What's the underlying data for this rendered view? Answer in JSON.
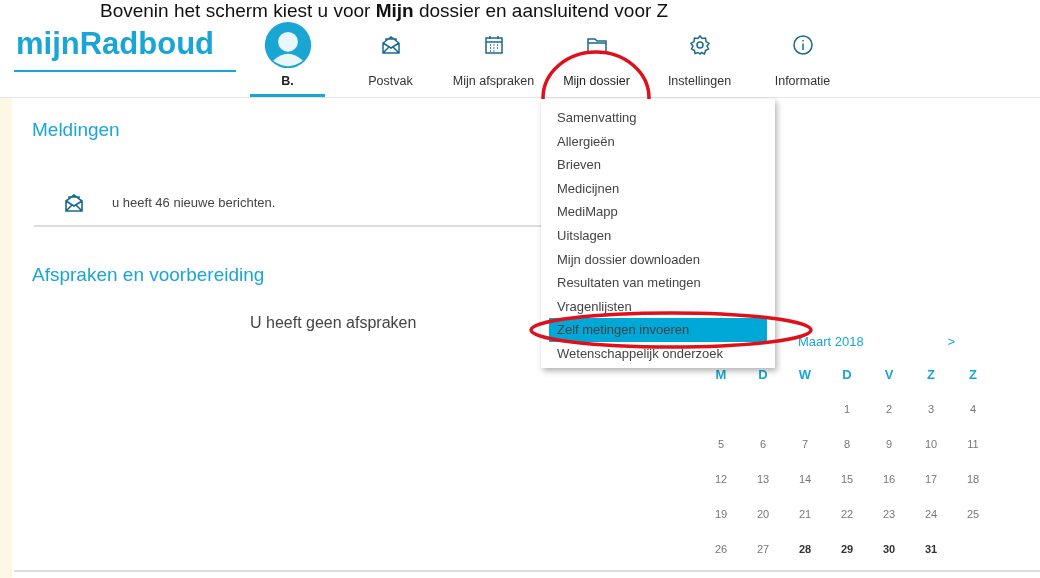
{
  "caption": "Bovenin het scherm kiest u voor **Mijn** dossier en aansluitend voor Z",
  "logo": "mijnRadboud",
  "nav": [
    {
      "kind": "avatar",
      "label": "B.",
      "selected": true,
      "circled": false
    },
    {
      "kind": "mail",
      "label": "Postvak",
      "selected": false,
      "circled": false
    },
    {
      "kind": "calendar",
      "label": "Mijn afspraken",
      "selected": false,
      "circled": false
    },
    {
      "kind": "folder",
      "label": "Mijn dossier",
      "selected": false,
      "circled": true
    },
    {
      "kind": "gear",
      "label": "Instellingen",
      "selected": false,
      "circled": false
    },
    {
      "kind": "info",
      "label": "Informatie",
      "selected": false,
      "circled": false
    }
  ],
  "menu": [
    {
      "label": "Samenvatting",
      "selected": false,
      "circled": false
    },
    {
      "label": "Allergieën",
      "selected": false,
      "circled": false
    },
    {
      "label": "Brieven",
      "selected": false,
      "circled": false
    },
    {
      "label": "Medicijnen",
      "selected": false,
      "circled": false
    },
    {
      "label": "MediMapp",
      "selected": false,
      "circled": false
    },
    {
      "label": "Uitslagen",
      "selected": false,
      "circled": false
    },
    {
      "label": "Mijn dossier downloaden",
      "selected": false,
      "circled": false
    },
    {
      "label": "Resultaten van metingen",
      "selected": false,
      "circled": false
    },
    {
      "label": "Vragenlijsten",
      "selected": false,
      "circled": false
    },
    {
      "label": "Zelf metingen invoeren",
      "selected": true,
      "circled": true
    },
    {
      "label": "Wetenschappelijk onderzoek",
      "selected": false,
      "circled": false
    }
  ],
  "notifications": {
    "title": "Meldingen",
    "message": "u heeft 46 nieuwe berichten."
  },
  "appointments": {
    "title": "Afspraken en voorbereiding",
    "empty_text": "U heeft geen afspraken"
  },
  "calendar": {
    "month": "Maart 2018",
    "next": ">",
    "weekdays": [
      "M",
      "D",
      "W",
      "D",
      "V",
      "Z",
      "Z"
    ],
    "weeks": [
      [
        {
          "kind": "blank"
        },
        {
          "kind": "blank"
        },
        {
          "kind": "blank"
        },
        {
          "kind": "day",
          "day": "1",
          "upcoming": false
        },
        {
          "kind": "day",
          "day": "2",
          "upcoming": false
        },
        {
          "kind": "day",
          "day": "3",
          "upcoming": false
        },
        {
          "kind": "day",
          "day": "4",
          "upcoming": false
        }
      ],
      [
        {
          "kind": "day",
          "day": "5",
          "upcoming": false
        },
        {
          "kind": "day",
          "day": "6",
          "upcoming": false
        },
        {
          "kind": "day",
          "day": "7",
          "upcoming": false
        },
        {
          "kind": "day",
          "day": "8",
          "upcoming": false
        },
        {
          "kind": "day",
          "day": "9",
          "upcoming": false
        },
        {
          "kind": "day",
          "day": "10",
          "upcoming": false
        },
        {
          "kind": "day",
          "day": "11",
          "upcoming": false
        }
      ],
      [
        {
          "kind": "day",
          "day": "12",
          "upcoming": false
        },
        {
          "kind": "day",
          "day": "13",
          "upcoming": false
        },
        {
          "kind": "day",
          "day": "14",
          "upcoming": false
        },
        {
          "kind": "day",
          "day": "15",
          "upcoming": false
        },
        {
          "kind": "day",
          "day": "16",
          "upcoming": false
        },
        {
          "kind": "day",
          "day": "17",
          "upcoming": false
        },
        {
          "kind": "day",
          "day": "18",
          "upcoming": false
        }
      ],
      [
        {
          "kind": "day",
          "day": "19",
          "upcoming": false
        },
        {
          "kind": "day",
          "day": "20",
          "upcoming": false
        },
        {
          "kind": "day",
          "day": "21",
          "upcoming": false
        },
        {
          "kind": "day",
          "day": "22",
          "upcoming": false
        },
        {
          "kind": "day",
          "day": "23",
          "upcoming": false
        },
        {
          "kind": "day",
          "day": "24",
          "upcoming": false
        },
        {
          "kind": "day",
          "day": "25",
          "upcoming": false
        }
      ],
      [
        {
          "kind": "day",
          "day": "26",
          "upcoming": false
        },
        {
          "kind": "day",
          "day": "27",
          "upcoming": false
        },
        {
          "kind": "day",
          "day": "28",
          "upcoming": true
        },
        {
          "kind": "day",
          "day": "29",
          "upcoming": true
        },
        {
          "kind": "day",
          "day": "30",
          "upcoming": true
        },
        {
          "kind": "day",
          "day": "31",
          "upcoming": true
        }
      ]
    ]
  }
}
